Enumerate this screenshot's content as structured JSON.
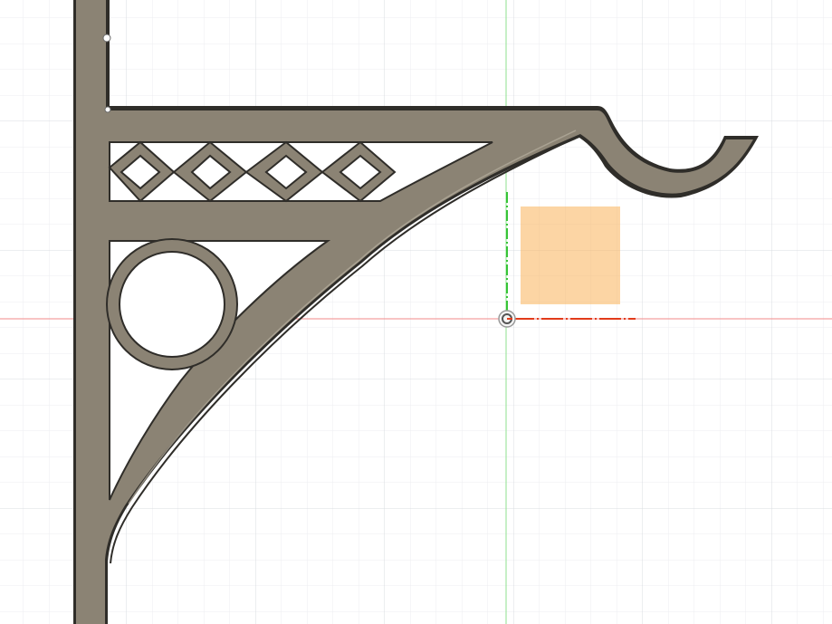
{
  "canvas": {
    "background_color": "#ffffff",
    "grid_minor_color": "#eceef1",
    "grid_major_color": "#d9dce0",
    "x_axis_color": "#f08a8a",
    "y_axis_color": "#8fe08f"
  },
  "model": {
    "name": "",
    "body_color": "#8b8374",
    "body_edge_color": "#2f2d29",
    "body_highlight_color": "#b7afa0"
  },
  "sketch_profile": {
    "fill_color": "#f9b35a",
    "fill_opacity": 0.55
  },
  "origin": {
    "icon": "origin-point-icon",
    "x_axis_highlight_color": "#e23b1a",
    "y_axis_highlight_color": "#36c436"
  },
  "vertex_marker": {
    "icon": "vertex-point-icon"
  }
}
